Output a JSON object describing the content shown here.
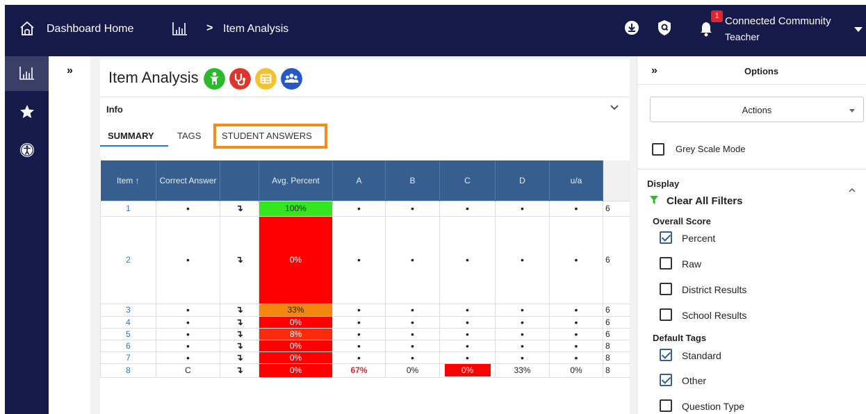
{
  "topbar": {
    "home_label": "Dashboard Home",
    "separator": ">",
    "breadcrumb_current": "Item Analysis",
    "notification_count": "1",
    "user_name": "Connected Community",
    "user_role": "Teacher"
  },
  "main": {
    "title": "Item Analysis",
    "info_label": "Info",
    "tabs": [
      {
        "label": "SUMMARY",
        "active": true
      },
      {
        "label": "TAGS",
        "active": false
      },
      {
        "label": "STUDENT ANSWERS",
        "active": false,
        "highlighted": true
      }
    ],
    "table": {
      "headers": [
        "Item ↑",
        "Correct Answer",
        "",
        "Avg. Percent",
        "A",
        "B",
        "C",
        "D",
        "u/a"
      ],
      "rows": [
        {
          "item": "1",
          "correct": "•",
          "icon": "↴",
          "avg": "100%",
          "avg_color": "#33e61f",
          "a": "•",
          "b": "•",
          "c": "•",
          "d": "•",
          "ua": "•",
          "extra": "6"
        },
        {
          "item": "2",
          "correct": "•",
          "icon": "↴",
          "avg": "0%",
          "avg_color": "#ff0000",
          "a": "•",
          "b": "•",
          "c": "•",
          "d": "•",
          "ua": "•",
          "extra": "6"
        },
        {
          "item": "3",
          "correct": "•",
          "icon": "↴",
          "avg": "33%",
          "avg_color": "#f5860f",
          "a": "•",
          "b": "•",
          "c": "•",
          "d": "•",
          "ua": "•",
          "extra": "6"
        },
        {
          "item": "4",
          "correct": "•",
          "icon": "↴",
          "avg": "0%",
          "avg_color": "#ff0000",
          "a": "•",
          "b": "•",
          "c": "•",
          "d": "•",
          "ua": "•",
          "extra": "6"
        },
        {
          "item": "5",
          "correct": "•",
          "icon": "↴",
          "avg": "8%",
          "avg_color": "#fb2a0d",
          "a": "•",
          "b": "•",
          "c": "•",
          "d": "•",
          "ua": "•",
          "extra": "6"
        },
        {
          "item": "6",
          "correct": "•",
          "icon": "↴",
          "avg": "0%",
          "avg_color": "#ff0000",
          "a": "•",
          "b": "•",
          "c": "•",
          "d": "•",
          "ua": "•",
          "extra": "8"
        },
        {
          "item": "7",
          "correct": "•",
          "icon": "↴",
          "avg": "0%",
          "avg_color": "#ff0000",
          "a": "•",
          "b": "•",
          "c": "•",
          "d": "•",
          "ua": "•",
          "extra": "8"
        },
        {
          "item": "8",
          "correct": "C",
          "icon": "↴",
          "avg": "0%",
          "avg_color": "#ff0000",
          "a": "67%",
          "b": "0%",
          "c": "0%",
          "d": "33%",
          "ua": "0%",
          "extra": "8"
        }
      ]
    }
  },
  "options": {
    "toggle_label": "»",
    "title": "Options",
    "actions_label": "Actions",
    "grey_scale_label": "Grey Scale Mode",
    "display_label": "Display",
    "clear_filters_label": "Clear All Filters",
    "overall_score_label": "Overall Score",
    "overall_score_options": [
      {
        "label": "Percent",
        "checked": true
      },
      {
        "label": "Raw",
        "checked": false
      },
      {
        "label": "District Results",
        "checked": false
      },
      {
        "label": "School Results",
        "checked": false
      }
    ],
    "default_tags_label": "Default Tags",
    "default_tags_options": [
      {
        "label": "Standard",
        "checked": true
      },
      {
        "label": "Other",
        "checked": true
      },
      {
        "label": "Question Type",
        "checked": false
      }
    ]
  },
  "collapse_toggle": "»",
  "colors": {
    "nav_bg": "#151a4a",
    "table_header": "#365f8f",
    "tab_underline": "#2f74c0",
    "highlight": "#f28c1a",
    "icon_green": "#2eb82e",
    "icon_red": "#e0352b",
    "icon_yellow": "#f2c230",
    "icon_blue": "#2558c7"
  }
}
